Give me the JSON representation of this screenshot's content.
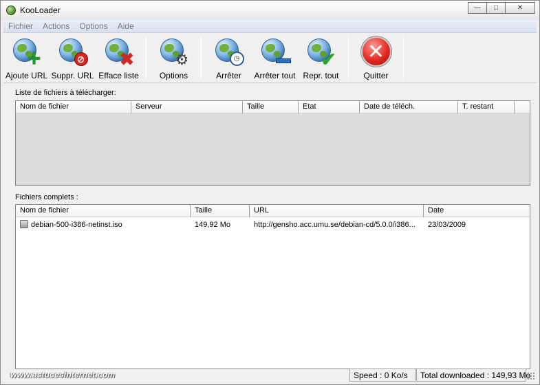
{
  "window": {
    "title": "KooLoader",
    "minimize_glyph": "—",
    "maximize_glyph": "□",
    "close_glyph": "✕"
  },
  "menu": [
    "Fichier",
    "Actions",
    "Options",
    "Aide"
  ],
  "toolbar": {
    "add_url": "Ajoute URL",
    "remove_url": "Suppr. URL",
    "clear_list": "Efface liste",
    "options": "Options",
    "stop": "Arrêter",
    "stop_all": "Arrêter tout",
    "resume_all": "Repr. tout",
    "quit": "Quitter"
  },
  "download_list": {
    "label": "Liste de fichiers à télécharger:",
    "columns": [
      "Nom de fichier",
      "Serveur",
      "Taille",
      "Etat",
      "Date de téléch.",
      "T. restant"
    ]
  },
  "completed_list": {
    "label": "Fichiers complets :",
    "columns": [
      "Nom de fichier",
      "Taille",
      "URL",
      "Date"
    ],
    "rows": [
      {
        "name": "debian-500-i386-netinst.iso",
        "size": "149,92 Mo",
        "url": "http://gensho.acc.umu.se/debian-cd/5.0.0/i386...",
        "date": "23/03/2009"
      }
    ]
  },
  "status": {
    "watermark": "www.astucesinternet.com",
    "speed": "Speed : 0 Ko/s",
    "total": "Total downloaded : 149,93 Mo"
  },
  "colors": {
    "window_bg": "#f0f0f0",
    "menubar_bg": "#dde4f2",
    "list_empty_bg": "#dcdcdc",
    "quit_red": "#e22a22",
    "add_green": "#1f9a2a"
  },
  "icons": {
    "add_url": "globe-plus-icon",
    "remove_url": "globe-no-entry-icon",
    "clear_list": "globe-x-icon",
    "options": "globe-gear-icon",
    "stop": "globe-clock-icon",
    "stop_all": "globe-minus-icon",
    "resume_all": "globe-check-icon",
    "quit": "quit-x-icon"
  }
}
